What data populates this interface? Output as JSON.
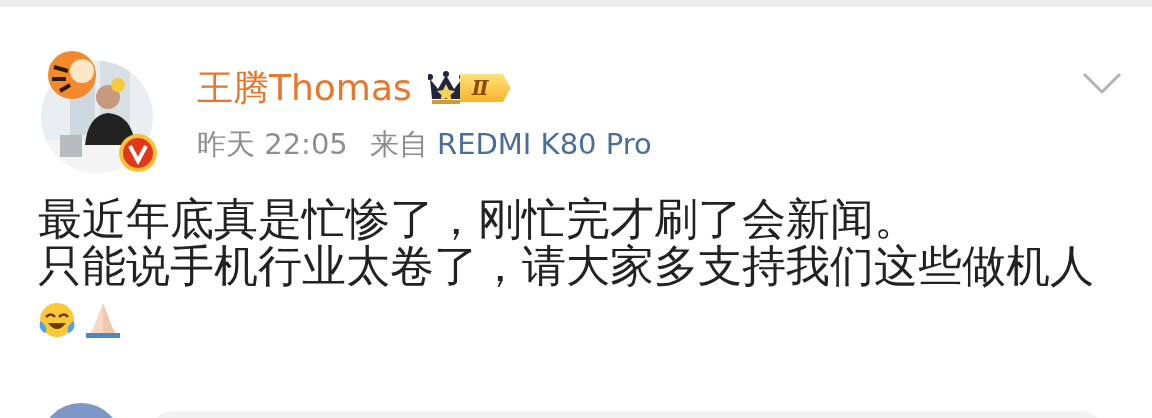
{
  "post": {
    "author": {
      "name": "王腾Thomas",
      "verified": true,
      "badge_level": "Ⅱ"
    },
    "time": "昨天 22:05",
    "source_prefix": "来自",
    "source": "REDMI K80 Pro",
    "body": [
      "最近年底真是忙惨了，刚忙完才刷了会新闻。",
      "只能说手机行业太卷了，请大家多支持我们这些做机人"
    ]
  }
}
